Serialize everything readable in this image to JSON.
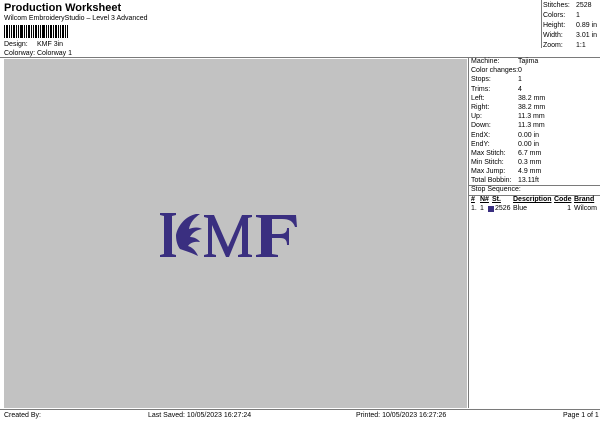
{
  "header": {
    "title": "Production Worksheet",
    "subtitle": "Wilcom EmbroideryStudio – Level 3 Advanced",
    "design_label": "Design:",
    "design_value": "KMF 3in",
    "colorway_label": "Colorway:",
    "colorway_value": "Colorway 1"
  },
  "top_stats": [
    {
      "label": "Stitches:",
      "value": "2528"
    },
    {
      "label": "Colors:",
      "value": "1"
    },
    {
      "label": "Height:",
      "value": "0.89 in"
    },
    {
      "label": "Width:",
      "value": "3.01 in"
    },
    {
      "label": "Zoom:",
      "value": "1:1"
    }
  ],
  "design": {
    "text": "KMF",
    "thread_color": "#3a2f80"
  },
  "machine_stats": [
    {
      "label": "Machine:",
      "value": "Tajima"
    },
    {
      "label": "Color changes:",
      "value": "0"
    },
    {
      "label": "Stops:",
      "value": "1"
    },
    {
      "label": "Trims:",
      "value": "4"
    },
    {
      "label": "Left:",
      "value": "38.2 mm"
    },
    {
      "label": "Right:",
      "value": "38.2 mm"
    },
    {
      "label": "Up:",
      "value": "11.3 mm"
    },
    {
      "label": "Down:",
      "value": "11.3 mm"
    },
    {
      "label": "EndX:",
      "value": "0.00 in"
    },
    {
      "label": "EndY:",
      "value": "0.00 in"
    },
    {
      "label": "Max Stitch:",
      "value": "6.7 mm"
    },
    {
      "label": "Min Stitch:",
      "value": "0.3 mm"
    },
    {
      "label": "Max Jump:",
      "value": "4.9 mm"
    },
    {
      "label": "Total Bobbin:",
      "value": "13.11ft"
    }
  ],
  "stop_sequence": {
    "label": "Stop Sequence:",
    "columns": [
      "#",
      "N#",
      "St.",
      "Description",
      "Code",
      "Brand"
    ],
    "rows": [
      {
        "num": "1.",
        "n": "1",
        "st": "2526",
        "description": "Blue",
        "code": "1",
        "brand": "Wilcom",
        "swatch": "#3a2f80"
      }
    ]
  },
  "footer": {
    "created_by": "Created By:",
    "last_saved": "Last Saved: 10/05/2023 16:27:24",
    "printed": "Printed: 10/05/2023 16:27:26",
    "page": "Page 1 of 1"
  }
}
